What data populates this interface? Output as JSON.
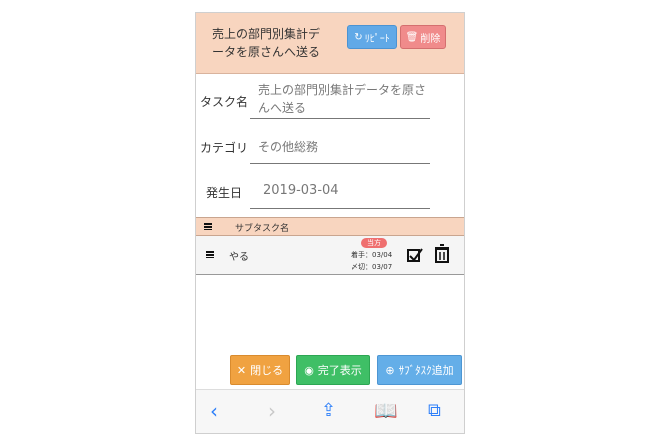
{
  "header": {
    "title_line1": "売上の部門別集計デ",
    "title_line2": "ータを原さんへ送る",
    "repeat_label": "ﾘﾋﾟｰﾄ",
    "delete_label": "削除"
  },
  "form": {
    "task_name_label": "タスク名",
    "task_name_line1": "売上の部門別集計データを原さ",
    "task_name_line2": "んへ送る",
    "category_label": "カテゴリ",
    "category_value": "その他総務",
    "date_label": "発生日",
    "date_value": "2019-03-04"
  },
  "subtasks": {
    "header_label": "サブタスク名",
    "items": [
      {
        "name": "やる",
        "badge": "当方",
        "start": "着手：03/04",
        "due": "〆切：03/07"
      }
    ]
  },
  "actions": {
    "close_label": "閉じる",
    "done_label": "完了表示",
    "add_label": "ｻﾌﾞﾀｽｸ追加"
  },
  "browser": {
    "back_icon": "back-icon",
    "forward_icon": "forward-icon",
    "share_icon": "share-icon",
    "bookmarks_icon": "bookmarks-icon",
    "tabs_icon": "tabs-icon"
  },
  "colors": {
    "header_bg": "#f8d5bf",
    "repeat": "#61a9e7",
    "delete": "#f08b8b",
    "close": "#f0a241",
    "done": "#3fbf66",
    "add": "#64aee8"
  }
}
